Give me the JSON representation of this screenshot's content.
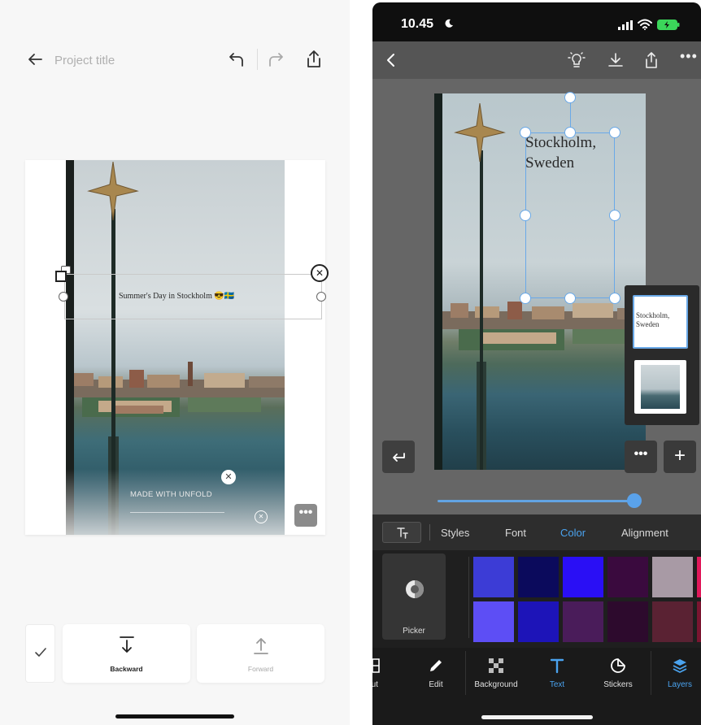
{
  "left": {
    "project_title": "Project title",
    "caption": "Summer's Day in Stockholm 😎🇸🇪",
    "watermark": "MADE WITH UNFOLD",
    "backward_label": "Backward",
    "forward_label": "Forward"
  },
  "right": {
    "status": {
      "time": "10.45"
    },
    "canvas_text_line1": "Stockholm,",
    "canvas_text_line2": "Sweden",
    "layer_thumb_text": "Stockholm, Sweden",
    "tabs": [
      {
        "label": "Styles"
      },
      {
        "label": "Font"
      },
      {
        "label": "Color"
      },
      {
        "label": "Alignment"
      }
    ],
    "picker_label": "Picker",
    "swatches_row1": [
      "#3c3cd6",
      "#0b0a5c",
      "#2a0ff5",
      "#3a0a3e",
      "#a89aa5",
      "#e0185a"
    ],
    "swatches_row2": [
      "#5d4ef5",
      "#1d14b8",
      "#4a1c5a",
      "#2d0a2d",
      "#5a2233",
      "#7a1530"
    ],
    "bottom_nav": [
      {
        "label": "out",
        "icon": "layout-icon"
      },
      {
        "label": "Edit",
        "icon": "pencil-icon"
      },
      {
        "label": "Background",
        "icon": "background-icon"
      },
      {
        "label": "Text",
        "icon": "text-icon"
      },
      {
        "label": "Stickers",
        "icon": "sticker-icon"
      },
      {
        "label": "Layers",
        "icon": "layers-icon"
      }
    ],
    "accent_color": "#4aa3ef"
  }
}
